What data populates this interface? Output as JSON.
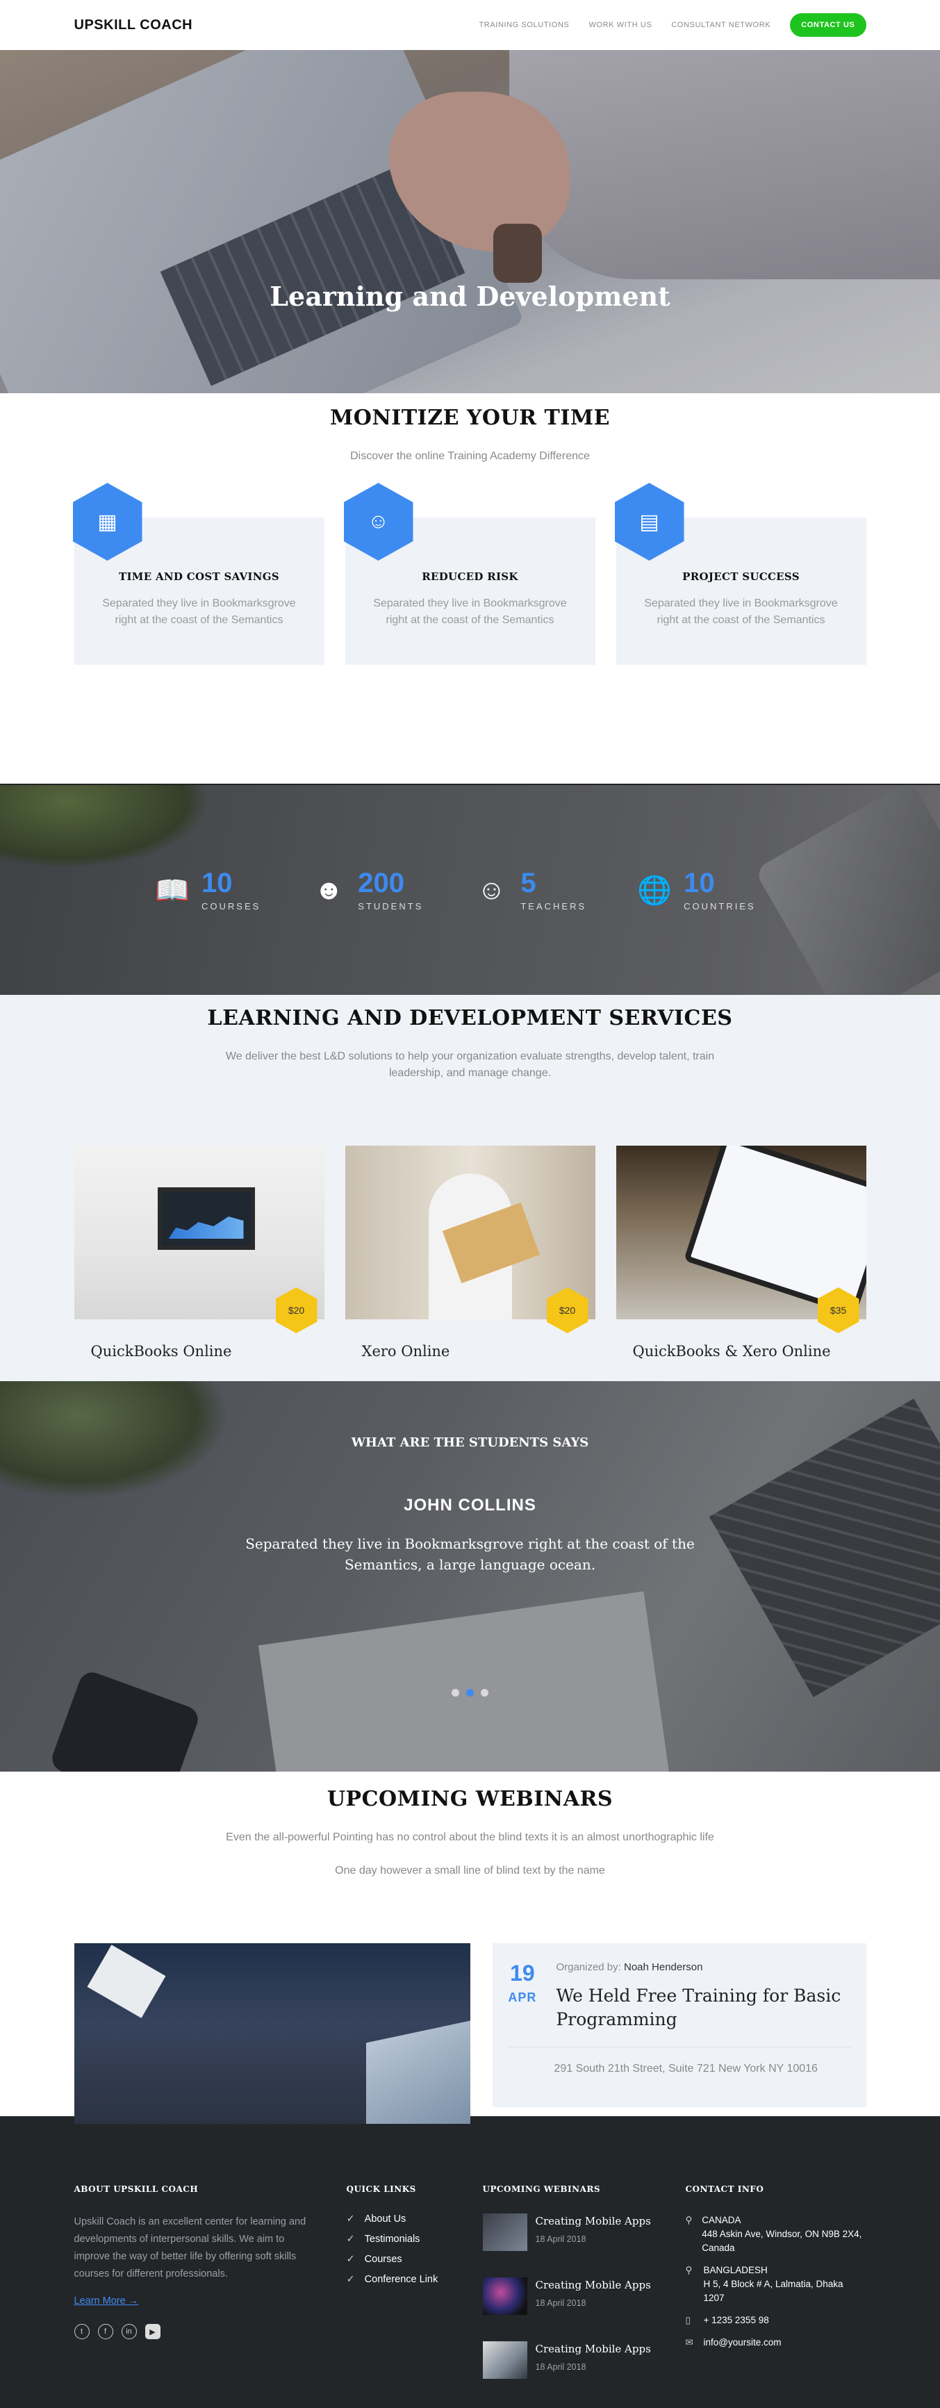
{
  "nav": {
    "brand": "UPSKILL COACH",
    "items": [
      "TRAINING SOLUTIONS",
      "WORK WITH US",
      "CONSULTANT NETWORK"
    ],
    "cta": "CONTACT US"
  },
  "hero": {
    "title": "Learning and Development",
    "slides": 3,
    "active_slide": 1
  },
  "monitize": {
    "title": "MONITIZE YOUR TIME",
    "subtitle": "Discover the online Training Academy Difference",
    "features": [
      {
        "icon": "building-icon",
        "title": "TIME AND COST SAVINGS",
        "text": "Separated they live in Bookmarksgrove right at the coast of the Semantics"
      },
      {
        "icon": "user-icon",
        "title": "REDUCED RISK",
        "text": "Separated they live in Bookmarksgrove right at the coast of the Semantics"
      },
      {
        "icon": "document-icon",
        "title": "PROJECT SUCCESS",
        "text": "Separated they live in Bookmarksgrove right at the coast of the Semantics"
      }
    ]
  },
  "stats": [
    {
      "icon": "course-book-icon",
      "number": "10",
      "label": "COURSES"
    },
    {
      "icon": "graduate-student-icon",
      "number": "200",
      "label": "STUDENTS"
    },
    {
      "icon": "teacher-icon",
      "number": "5",
      "label": "TEACHERS"
    },
    {
      "icon": "globe-icon",
      "number": "10",
      "label": "COUNTRIES"
    }
  ],
  "services": {
    "title": "LEARNING AND DEVELOPMENT SERVICES",
    "subtitle": "We deliver the best L&D solutions to help your organization evaluate strengths, develop talent, train leadership, and manage change.",
    "courses": [
      {
        "name": "QuickBooks Online",
        "price": "$20"
      },
      {
        "name": "Xero Online",
        "price": "$20"
      },
      {
        "name": "QuickBooks & Xero Online",
        "price": "$35"
      }
    ]
  },
  "testimonial": {
    "title": "WHAT ARE THE STUDENTS SAYS",
    "name": "JOHN COLLINS",
    "quote": "Separated they live in Bookmarksgrove right at the coast of the Semantics, a large language ocean.",
    "slides": 3,
    "active_slide": 2
  },
  "webinars": {
    "title": "UPCOMING WEBINARS",
    "subtitle_line1": "Even the all-powerful Pointing has no control about the blind texts it is an almost unorthographic life",
    "subtitle_line2": "One day however a small line of blind text by the name",
    "event": {
      "day": "19",
      "month": "APR",
      "organized_label": "Organized by:",
      "organizer": "Noah Henderson",
      "title": "We Held Free Training for Basic Programming",
      "address": "291 South 21th Street, Suite 721 New York NY 10016"
    }
  },
  "footer": {
    "about": {
      "heading": "ABOUT UPSKILL COACH",
      "text": "Upskill Coach is an excellent center for learning and developments of interpersonal skills. We aim to improve the way of better life by offering soft skills courses for different professionals.",
      "learn_more": "Learn More"
    },
    "quick_links": {
      "heading": "QUICK LINKS",
      "links": [
        "About Us",
        "Testimonials",
        "Courses",
        "Conference Link"
      ]
    },
    "upcoming": {
      "heading": "UPCOMING WEBINARS",
      "posts": [
        {
          "title": "Creating Mobile Apps",
          "date": "18 April 2018"
        },
        {
          "title": "Creating Mobile Apps",
          "date": "18 April 2018"
        },
        {
          "title": "Creating Mobile Apps",
          "date": "18 April 2018"
        }
      ]
    },
    "contact": {
      "heading": "CONTACT INFO",
      "canada_label": "CANADA",
      "canada_address": "448 Askin Ave, Windsor, ON N9B 2X4, Canada",
      "bangladesh_label": "BANGLADESH",
      "bangladesh_address": "H 5, 4 Block # A, Lalmatia, Dhaka 1207",
      "phone": "+ 1235 2355 98",
      "email": "info@yoursite.com"
    },
    "socials": [
      "twitter-icon",
      "facebook-icon",
      "linkedin-icon",
      "youtube-icon"
    ]
  },
  "colors": {
    "accent": "#3d8bf0",
    "cta": "#1ec41e",
    "price": "#f5c518",
    "footer_bg": "#232629"
  }
}
